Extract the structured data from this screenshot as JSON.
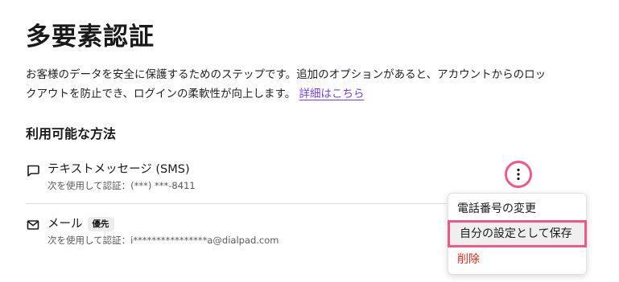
{
  "page": {
    "title": "多要素認証",
    "description": "お客様のデータを安全に保護するためのステップです。追加のオプションがあると、アカウントからのロックアウトを防止でき、ログインの柔軟性が向上します。",
    "learn_more": "詳細はこちら",
    "section_heading": "利用可能な方法"
  },
  "methods": [
    {
      "icon": "message-bubble-icon",
      "title": "テキストメッセージ (SMS)",
      "detail": "次を使用して認証：(***) ***-8411"
    },
    {
      "icon": "envelope-icon",
      "title": "メール",
      "badge": "優先",
      "detail": "次を使用して認証：i****************a@dialpad.com"
    }
  ],
  "menu": {
    "trigger_icon": "more-vertical-icon",
    "items": [
      {
        "label": "電話番号の変更",
        "tone": "default"
      },
      {
        "label": "自分の設定として保存",
        "tone": "highlighted"
      },
      {
        "label": "削除",
        "tone": "danger"
      }
    ]
  },
  "colors": {
    "link": "#7a3cf0",
    "highlight_outline": "#f0588a",
    "danger": "#e02a1e",
    "badge_bg": "#ececec"
  }
}
